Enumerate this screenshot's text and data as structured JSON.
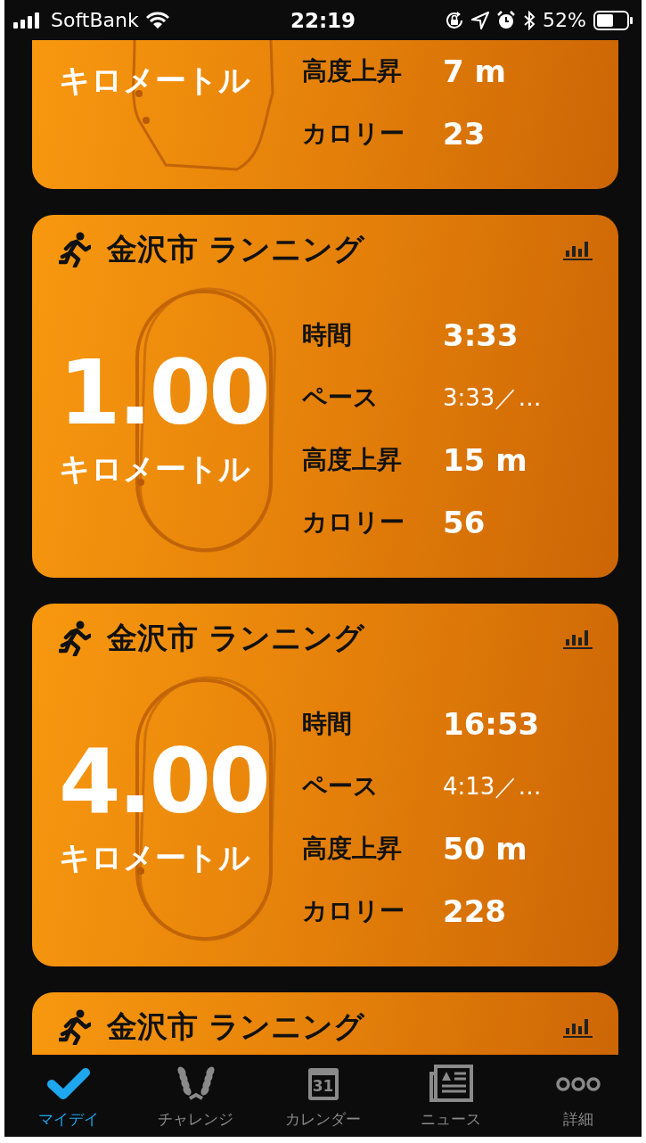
{
  "status_bar": {
    "carrier": "SoftBank",
    "time": "22:19",
    "battery": "52%"
  },
  "workouts": [
    {
      "partial": true,
      "unit": "キロメートル",
      "stats": [
        {
          "label": "高度上昇",
          "value": "7 m",
          "kind": "normal"
        },
        {
          "label": "カロリー",
          "value": "23",
          "kind": "normal"
        }
      ]
    },
    {
      "partial": false,
      "title": "金沢市 ランニング",
      "distance": "1.00",
      "unit": "キロメートル",
      "stats": [
        {
          "label": "時間",
          "value": "3:33",
          "kind": "normal"
        },
        {
          "label": "ペース",
          "value": "3:33／…",
          "kind": "compact"
        },
        {
          "label": "高度上昇",
          "value": "15 m",
          "kind": "normal"
        },
        {
          "label": "カロリー",
          "value": "56",
          "kind": "normal"
        }
      ]
    },
    {
      "partial": false,
      "title": "金沢市 ランニング",
      "distance": "4.00",
      "unit": "キロメートル",
      "stats": [
        {
          "label": "時間",
          "value": "16:53",
          "kind": "normal"
        },
        {
          "label": "ペース",
          "value": "4:13／…",
          "kind": "compact"
        },
        {
          "label": "高度上昇",
          "value": "50 m",
          "kind": "normal"
        },
        {
          "label": "カロリー",
          "value": "228",
          "kind": "normal"
        }
      ]
    },
    {
      "partial": false,
      "title": "金沢市 ランニング"
    }
  ],
  "tab_bar": [
    {
      "kind": "check",
      "label": "マイデイ",
      "selected": true
    },
    {
      "kind": "laurel",
      "label": "チャレンジ",
      "selected": false
    },
    {
      "kind": "calendar",
      "badge": "31",
      "label": "カレンダー",
      "selected": false
    },
    {
      "kind": "news",
      "label": "ニュース",
      "selected": false
    },
    {
      "kind": "more",
      "label": "詳細",
      "selected": false
    }
  ]
}
